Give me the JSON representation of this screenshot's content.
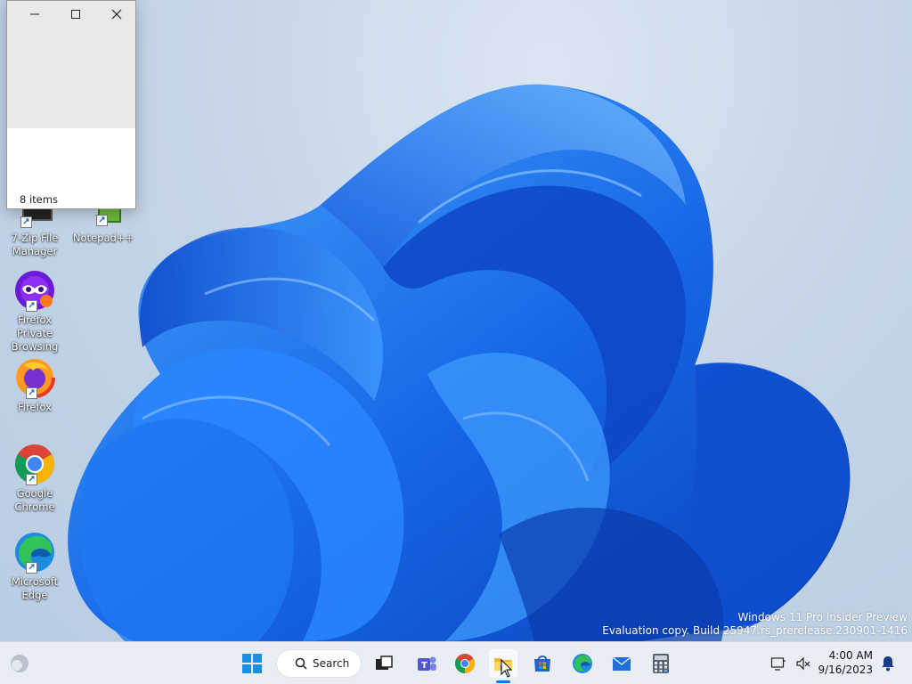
{
  "window": {
    "status_text": "8 items",
    "controls": [
      "minimize",
      "maximize",
      "close"
    ]
  },
  "desktop_icons": [
    {
      "label": "7-Zip File Manager",
      "icon": "7zip-icon"
    },
    {
      "label": "Notepad++",
      "icon": "notepadpp-icon"
    },
    {
      "label": "Firefox Private Browsing",
      "icon": "firefox-private-icon"
    },
    {
      "label": "Firefox",
      "icon": "firefox-icon"
    },
    {
      "label": "Google Chrome",
      "icon": "chrome-icon"
    },
    {
      "label": "Microsoft Edge",
      "icon": "edge-icon"
    }
  ],
  "watermark": {
    "line1": "Windows 11 Pro Insider Preview",
    "line2": "Evaluation copy. Build 25947.rs_prerelease.230901-1416"
  },
  "taskbar": {
    "search_label": "Search",
    "pinned": [
      "start-icon",
      "search-icon",
      "task-view-icon",
      "teams-icon",
      "chrome-icon",
      "file-explorer-icon",
      "store-icon",
      "edge-icon",
      "mail-icon",
      "calculator-icon"
    ],
    "clock": {
      "time": "4:00 AM",
      "date": "9/16/2023"
    }
  },
  "colors": {
    "wallpaper_bg": "#c9d9ea",
    "bloom_blue": "#1565e0",
    "taskbar_bg": "#e9eef4",
    "accent": "#1a73e8"
  }
}
